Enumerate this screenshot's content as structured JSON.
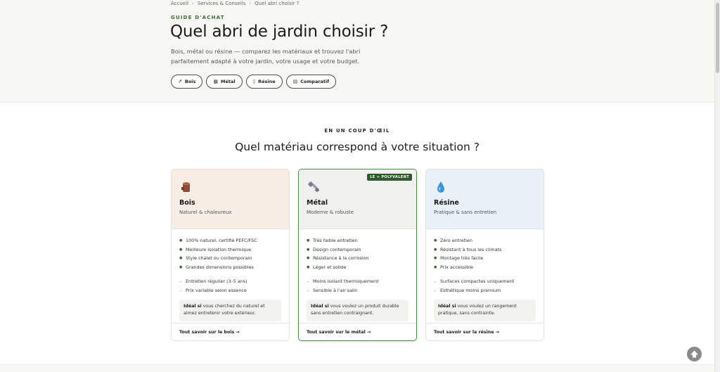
{
  "breadcrumb": [
    "Accueil",
    "Services & Conseils",
    "Quel abri choisir ?"
  ],
  "hero": {
    "eyebrow": "GUIDE D'ACHAT",
    "title": "Quel abri de jardin choisir ?",
    "intro": "Bois, métal ou résine — comparez les matériaux et trouvez l'abri parfaitement adapté à votre jardin, votre usage et votre budget."
  },
  "chips": [
    {
      "label": "Bois",
      "icon": "↗"
    },
    {
      "label": "Métal",
      "icon": "▦"
    },
    {
      "label": "Résine",
      "icon": "◊"
    },
    {
      "label": "Comparatif",
      "icon": "▤"
    }
  ],
  "section": {
    "eyebrow": "EN UN COUP D'ŒIL",
    "title": "Quel matériau correspond à votre situation ?"
  },
  "cards": [
    {
      "name": "Bois",
      "subtitle": "Naturel & chaleureux",
      "pros": [
        "100% naturel, certifié PEFC/FSC",
        "Meilleure isolation thermique",
        "Style chalet ou contemporain",
        "Grandes dimensions possibles"
      ],
      "cons": [
        "Entretien régulier (3–5 ans)",
        "Prix variable selon essence"
      ],
      "ideal_label": "Idéal si",
      "ideal_text": " vous cherchez du naturel et aimez entretenir votre extérieur.",
      "link": "Tout savoir sur le bois →"
    },
    {
      "name": "Métal",
      "subtitle": "Moderne & robuste",
      "badge": "LE + POLYVALENT",
      "pros": [
        "Très faible entretien",
        "Design contemporain",
        "Résistance à la corrosion",
        "Léger et solide"
      ],
      "cons": [
        "Moins isolant thermiquement",
        "Sensible à l'air salin"
      ],
      "ideal_label": "Idéal si",
      "ideal_text": " vous voulez un produit durable sans entretien contraignant.",
      "link": "Tout savoir sur le métal →"
    },
    {
      "name": "Résine",
      "subtitle": "Pratique & sans entretien",
      "pros": [
        "Zéro entretien",
        "Résistant à tous les climats",
        "Montage très facile",
        "Prix accessible"
      ],
      "cons": [
        "Surfaces compactes uniquement",
        "Esthétique moins premium"
      ],
      "ideal_label": "Idéal si",
      "ideal_text": " vous voulez un rangement pratique, sans contrainte.",
      "link": "Tout savoir sur la résine →"
    }
  ],
  "colors": {
    "accent": "#3d6b3a",
    "badge": "#2f5a2c",
    "wood_bg": "#f7ede5",
    "metal_bg": "#f0f0ef",
    "resin_bg": "#e8f0f8"
  }
}
